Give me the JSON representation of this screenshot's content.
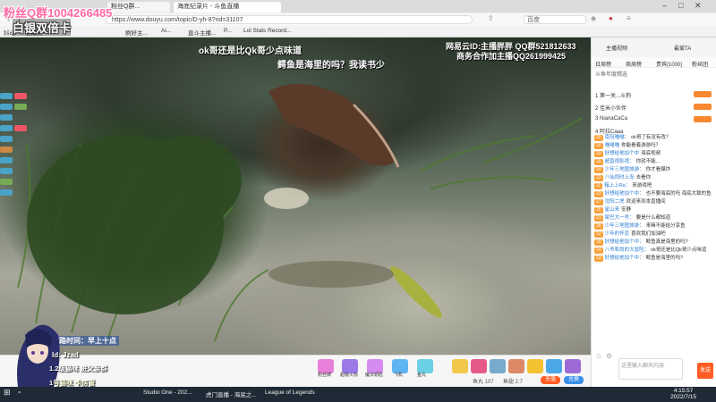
{
  "overlay": {
    "fan_group": "粉丝Q群1004266485",
    "silver_card": "白银双倍卡",
    "top_caption_1": "ok哥还是比Qk哥少点味道",
    "top_caption_2": "鳄鱼是海里的吗？我读书少",
    "right_caption_1": "网易云ID:主播胖胖 QQ群521812633",
    "right_caption_2": "商务合作加主播QQ261999425",
    "bottom_caption": "宝藏路时间：早上十点",
    "streamer_id": "Id: Jzad",
    "follow_1": "1.2级猫咪  进父亲群",
    "follow_2": "1号猫咪  卡房管"
  },
  "browser": {
    "tabs": [
      "粉丝Q群...",
      "海底纪录片 - 斗鱼直播"
    ],
    "url": "https://www.douyu.com/topic/D-yh-8?rid=31107",
    "search_placeholder": "百度",
    "bookmarks": [
      "抖动",
      "收藏夹",
      "刷好主...",
      "Ai...",
      "直斗主播...",
      "P...",
      "Lol Stats Record..."
    ]
  },
  "right_panel": {
    "tabs": [
      "主播视频",
      "最爱TA",
      "贡献周榜",
      "粉丝"
    ],
    "subtabs": [
      "日周榜",
      "周周榜",
      "贵宾(1000)",
      "粉丝团"
    ],
    "rank_header": "斗鱼年度精选",
    "ranks": [
      {
        "pos": "1",
        "name": "第一关...斗狗"
      },
      {
        "pos": "2",
        "name": "佳米小伙伴"
      },
      {
        "pos": "3",
        "name": "NianaCaCa"
      },
      {
        "pos": "4",
        "name": "阿拉Caaa"
      }
    ],
    "messages": [
      {
        "lv": "20",
        "name": "南冠喵喵：",
        "text": "ok哥了有没有改？"
      },
      {
        "lv": "16",
        "name": "喵喵喵",
        "text": "你能看着游游吗？"
      },
      {
        "lv": "19",
        "name": "好想给他加个中",
        "text": "海底视频"
      },
      {
        "lv": "15",
        "name": "超直视影视：",
        "text": "你就不能..."
      },
      {
        "lv": "14",
        "name": "少年三地图旅游：",
        "text": "你才看爆炸"
      },
      {
        "lv": "12",
        "name": "八仙同时上岛",
        "text": "去看你"
      },
      {
        "lv": "11",
        "name": "箱上上Ra：",
        "text": "来游戏吧"
      },
      {
        "lv": "13",
        "name": "好想给他加个中：",
        "text": "也不要海底的吗 海底大致的鱼"
      },
      {
        "lv": "17",
        "name": "沈阳二虎",
        "text": "欢迎来到本直播间"
      },
      {
        "lv": "15",
        "name": "星山来",
        "text": "安静"
      },
      {
        "lv": "21",
        "name": "尾巴大一号：",
        "text": "要是什么都知道"
      },
      {
        "lv": "18",
        "name": "少年三地图旅游：",
        "text": "来嘛不能给分享鱼"
      },
      {
        "lv": "12",
        "name": "少年的怀恋",
        "text": "喜欢我们加油吧"
      },
      {
        "lv": "16",
        "name": "好想给他加个中：",
        "text": "鲸鱼真是海里的吗?"
      },
      {
        "lv": "14",
        "name": "八爷和尚的大冒险：",
        "text": "ok哥还是比Qk哥少点味道"
      },
      {
        "lv": "13",
        "name": "好想给他加个中：",
        "text": "鲸鱼是海里的吗?"
      }
    ],
    "input_placeholder": "这里输入聊天内容",
    "send_label": "发送"
  },
  "bottom_bar": {
    "gifts": [
      "粉丝牌",
      "超级火箭",
      "魔法钥匙",
      "飞机",
      "鱼丸"
    ],
    "stat_1": "鱼丸 107",
    "stat_2": "鱼翅 2.7",
    "charge_label": "充值",
    "buy_label": "兑换"
  },
  "taskbar": {
    "items": [
      "Studio One - 202...",
      "虎门直播 - 海底之...",
      "League of Legends"
    ],
    "time": "4:15:57",
    "date": "2022/7/15"
  }
}
